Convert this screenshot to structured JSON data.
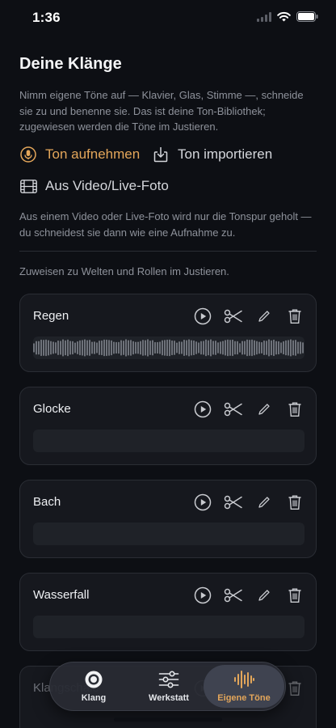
{
  "status": {
    "time": "1:36",
    "icons": [
      "cellular-signal-icon",
      "wifi-icon",
      "battery-icon"
    ]
  },
  "page": {
    "title": "Deine Klänge",
    "intro": "Nimm eigene Töne auf — Klavier, Glas, Stimme —, schneide sie zu und benenne sie. Das ist deine Ton-Bibliothek; zugewiesen werden die Töne im Justieren.",
    "video_note": "Aus einem Video oder Live-Foto wird nur die Tonspur geholt — du schneidest sie dann wie eine Aufnahme zu.",
    "assign_note": "Zuweisen zu Welten und Rollen im Justieren."
  },
  "actions": {
    "record": {
      "label": "Ton aufnehmen",
      "icon": "microphone-icon"
    },
    "import": {
      "label": "Ton importieren",
      "icon": "download-tray-icon"
    },
    "video": {
      "label": "Aus Video/Live-Foto",
      "icon": "film-strip-icon"
    }
  },
  "sounds": [
    {
      "name": "Regen",
      "has_waveform": true
    },
    {
      "name": "Glocke",
      "has_waveform": false
    },
    {
      "name": "Bach",
      "has_waveform": false
    },
    {
      "name": "Wasserfall",
      "has_waveform": false
    },
    {
      "name": "Klangschale",
      "has_waveform": false
    }
  ],
  "card_tools": [
    "play-icon",
    "scissors-icon",
    "pencil-icon",
    "trash-icon"
  ],
  "tabbar": {
    "tabs": [
      {
        "label": "Klang",
        "icon": "target-circle-icon"
      },
      {
        "label": "Werkstatt",
        "icon": "sliders-icon"
      },
      {
        "label": "Eigene Töne",
        "icon": "waveform-icon",
        "selected": true
      }
    ]
  },
  "colors": {
    "accent": "#E3A65A",
    "background": "#0D0F14",
    "card": "#16181E",
    "muted_text": "#8E929B"
  }
}
